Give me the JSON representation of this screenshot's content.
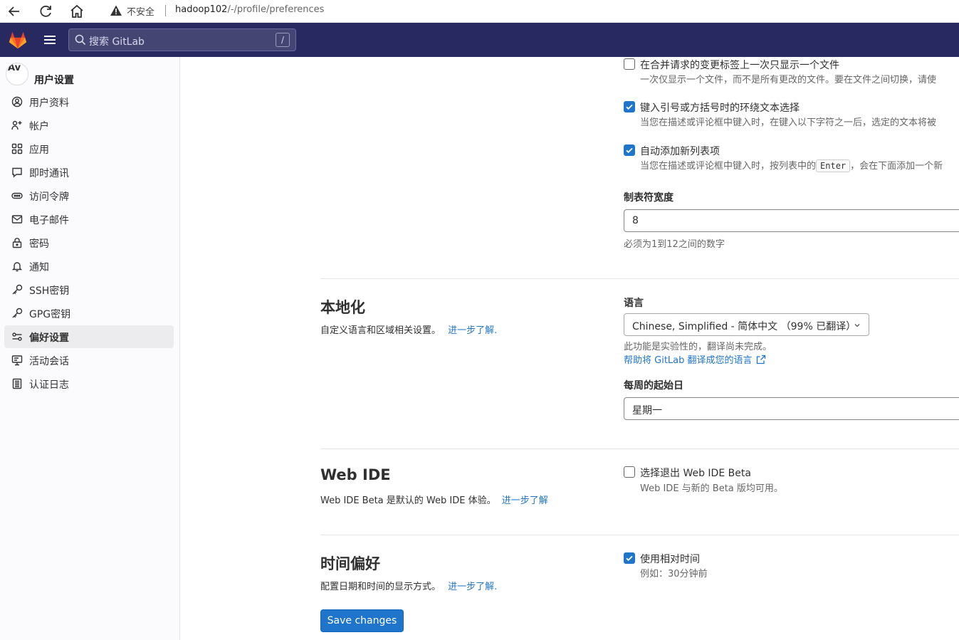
{
  "browser": {
    "insecure_label": "不安全",
    "url_host": "hadoop102",
    "url_path": "/-/profile/preferences"
  },
  "header": {
    "search_placeholder": "搜索 GitLab",
    "search_shortcut": "/"
  },
  "sidebar": {
    "avatar_text": "Av",
    "title": "用户设置",
    "items": [
      {
        "label": "用户资料",
        "icon": "user-icon"
      },
      {
        "label": "帐户",
        "icon": "account-icon"
      },
      {
        "label": "应用",
        "icon": "applications-icon"
      },
      {
        "label": "即时通讯",
        "icon": "comment-icon"
      },
      {
        "label": "访问令牌",
        "icon": "token-icon"
      },
      {
        "label": "电子邮件",
        "icon": "mail-icon"
      },
      {
        "label": "密码",
        "icon": "lock-icon"
      },
      {
        "label": "通知",
        "icon": "bell-icon"
      },
      {
        "label": "SSH密钥",
        "icon": "key-icon"
      },
      {
        "label": "GPG密钥",
        "icon": "key-icon"
      },
      {
        "label": "偏好设置",
        "icon": "preferences-icon",
        "active": true
      },
      {
        "label": "活动会话",
        "icon": "monitor-icon"
      },
      {
        "label": "认证日志",
        "icon": "log-icon"
      }
    ]
  },
  "behavior": {
    "single_file": {
      "label": "在合并请求的变更标签上一次只显示一个文件",
      "help": "一次仅显示一个文件，而不是所有更改的文件。要在文件之间切换，请使",
      "checked": false
    },
    "surround": {
      "label": "键入引号或方括号时的环绕文本选择",
      "help": "当您在描述或评论框中键入时，在键入以下字符之一后，选定的文本将被",
      "checked": true
    },
    "autolist": {
      "label": "自动添加新列表项",
      "help_before": "当您在描述或评论框中键入时，按列表中的",
      "help_key": "Enter",
      "help_after": "，会在下面添加一个新",
      "checked": true
    },
    "tab_width": {
      "label": "制表符宽度",
      "value": "8",
      "help": "必须为1到12之间的数字"
    }
  },
  "localization": {
    "title": "本地化",
    "desc": "自定义语言和区域相关设置。",
    "learn_more": "进一步了解.",
    "language_label": "语言",
    "language_value": "Chinese, Simplified - 简体中文 （99% 已翻译）",
    "experimental_note": "此功能是实验性的，翻译尚未完成。",
    "help_translate": "帮助将 GitLab 翻译成您的语言",
    "first_day_label": "每周的起始日",
    "first_day_value": "星期一"
  },
  "web_ide": {
    "title": "Web IDE",
    "desc": "Web IDE Beta 是默认的 Web IDE 体验。",
    "learn_more": "进一步了解",
    "opt_out_label": "选择退出 Web IDE Beta",
    "opt_out_help": "Web IDE 与新的 Beta 版均可用。",
    "checked": false
  },
  "time": {
    "title": "时间偏好",
    "desc": "配置日期和时间的显示方式。",
    "learn_more": "进一步了解.",
    "relative_label": "使用相对时间",
    "relative_help": "例如：30分钟前",
    "checked": true
  },
  "actions": {
    "save_label": "Save changes"
  },
  "colors": {
    "header_bg": "#292961",
    "primary": "#1f75cb",
    "sidebar_bg": "#fbfafd"
  }
}
